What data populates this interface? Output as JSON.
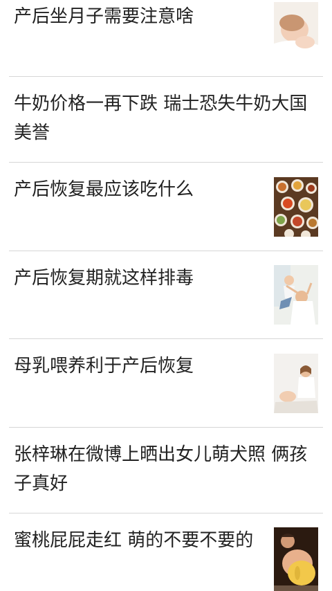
{
  "feed": {
    "items": [
      {
        "title": "产后坐月子需要注意啥",
        "thumbnail": "mother-baby-sleeping-image"
      },
      {
        "title": "牛奶价格一再下跌 瑞士恐失牛奶大国美誉"
      },
      {
        "title": "产后恢复最应该吃什么",
        "thumbnail": "food-dishes-image"
      },
      {
        "title": "产后恢复期就这样排毒",
        "thumbnail": "mother-lifting-baby-image"
      },
      {
        "title": "母乳喂养利于产后恢复",
        "thumbnail": "mother-with-baby-image"
      },
      {
        "title": "张梓琳在微博上晒出女儿萌犬照 俩孩子真好"
      },
      {
        "title": "蜜桃屁屁走红 萌的不要不要的",
        "thumbnail": "baby-crawling-image"
      }
    ]
  }
}
